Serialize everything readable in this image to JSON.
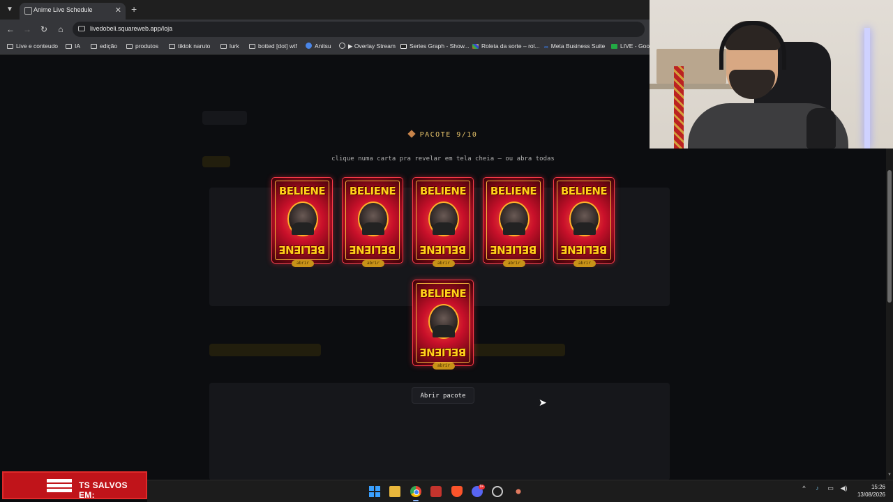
{
  "browser": {
    "tab_title": "Anime Live Schedule",
    "url": "livedobeli.squareweb.app/loja",
    "bookmarks": [
      {
        "label": "Live e conteudo",
        "icon": "folder-icon"
      },
      {
        "label": "IA",
        "icon": "folder-icon"
      },
      {
        "label": "edição",
        "icon": "folder-icon"
      },
      {
        "label": "produtos",
        "icon": "folder-icon"
      },
      {
        "label": "tiktok naruto",
        "icon": "folder-icon"
      },
      {
        "label": "lurk",
        "icon": "folder-icon"
      },
      {
        "label": "botted [dot] wtf",
        "icon": "folder-icon"
      },
      {
        "label": "Anitsu",
        "icon": "site-icon"
      },
      {
        "label": "▶ Overlay Stream",
        "icon": "globe-icon"
      },
      {
        "label": "Series Graph - Show...",
        "icon": "s-icon"
      },
      {
        "label": "Roleta da sorte – rol...",
        "icon": "wheel-icon"
      },
      {
        "label": "Meta Business Suite",
        "icon": "meta-icon"
      },
      {
        "label": "LIVE - Goog",
        "icon": "sheets-icon"
      }
    ]
  },
  "page": {
    "pack_title": "PACOTE 9/10",
    "hint": "clique numa carta pra revelar em tela cheia — ou abra todas",
    "card_name": "BELIENE",
    "card_tag": "abrir",
    "open_button": "Abrir pacote",
    "cards_count": 6
  },
  "overlay": {
    "badge_text": "TS SALVOS EM:"
  },
  "taskbar": {
    "time": "15:26",
    "date": "13/08/2026",
    "discord_badge": "9+"
  },
  "colors": {
    "accent_gold": "#e7c36a",
    "card_red": "#c8102a",
    "card_border": "#ff3b4a",
    "page_bg": "#0c0d10"
  }
}
